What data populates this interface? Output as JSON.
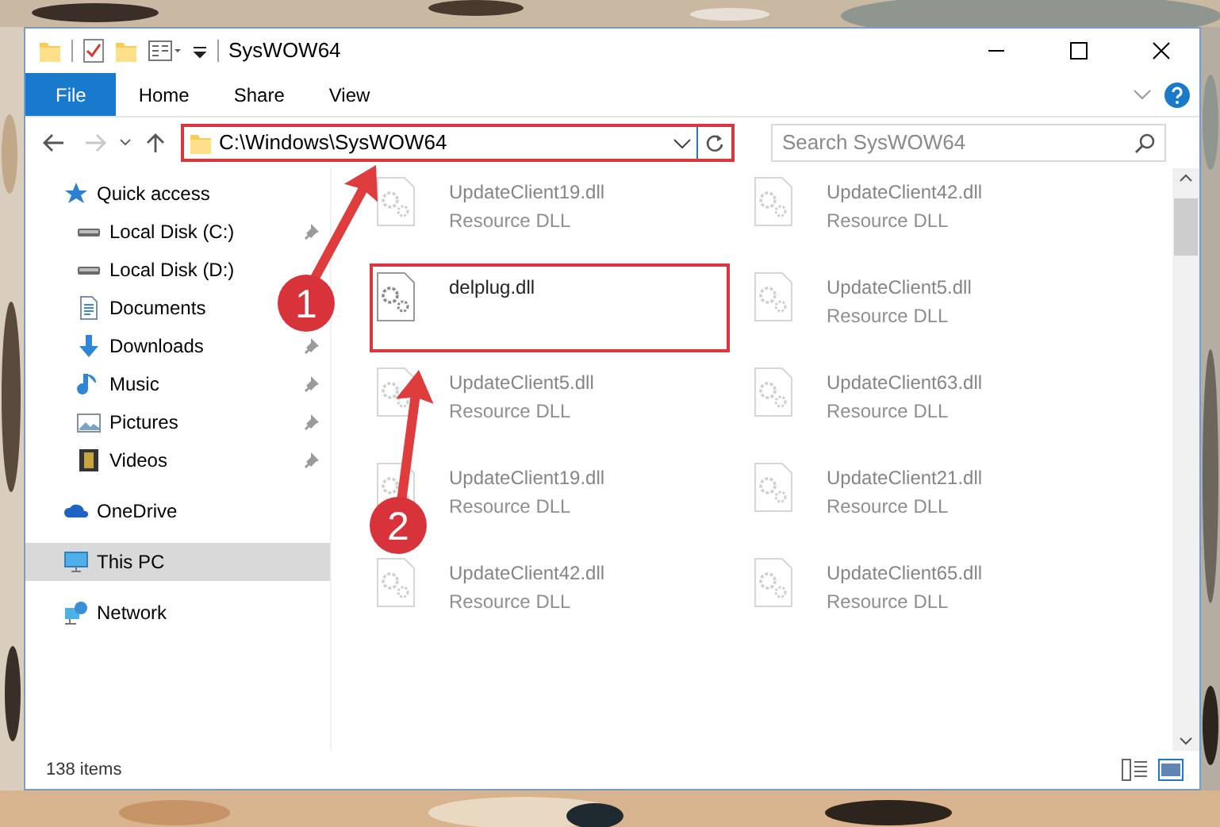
{
  "window": {
    "title": "SysWOW64"
  },
  "ribbon_tabs": [
    {
      "label": "File",
      "selected": true
    },
    {
      "label": "Home",
      "selected": false
    },
    {
      "label": "Share",
      "selected": false
    },
    {
      "label": "View",
      "selected": false
    }
  ],
  "address": {
    "path": "C:\\Windows\\SysWOW64",
    "highlighted": true
  },
  "search": {
    "placeholder": "Search SysWOW64"
  },
  "sidebar": {
    "items": [
      {
        "label": "Quick access",
        "kind": "star",
        "selected": false,
        "children": [
          {
            "label": "Local Disk (C:)",
            "kind": "drive",
            "pinned": true,
            "selected": false
          },
          {
            "label": "Local Disk (D:)",
            "kind": "drive",
            "pinned": false,
            "selected": false
          },
          {
            "label": "Documents",
            "kind": "document",
            "pinned": false,
            "selected": false
          },
          {
            "label": "Downloads",
            "kind": "download",
            "pinned": true,
            "selected": false
          },
          {
            "label": "Music",
            "kind": "music",
            "pinned": true,
            "selected": false
          },
          {
            "label": "Pictures",
            "kind": "picture",
            "pinned": true,
            "selected": false
          },
          {
            "label": "Videos",
            "kind": "video",
            "pinned": true,
            "selected": false
          }
        ]
      },
      {
        "label": "OneDrive",
        "kind": "cloud",
        "selected": false
      },
      {
        "label": "This PC",
        "kind": "computer",
        "selected": true
      },
      {
        "label": "Network",
        "kind": "network",
        "selected": false
      }
    ]
  },
  "files": [
    {
      "name": "UpdateClient19.dll",
      "type": "Resource DLL",
      "faded": true,
      "highlighted": false
    },
    {
      "name": "UpdateClient42.dll",
      "type": "Resource DLL",
      "faded": true,
      "highlighted": false
    },
    {
      "name": "delplug.dll",
      "faded": false,
      "highlighted": true
    },
    {
      "name": "UpdateClient5.dll",
      "type": "Resource DLL",
      "faded": true,
      "highlighted": false
    },
    {
      "name": "UpdateClient5.dll",
      "type": "Resource DLL",
      "faded": true,
      "highlighted": false
    },
    {
      "name": "UpdateClient63.dll",
      "type": "Resource DLL",
      "faded": true,
      "highlighted": false
    },
    {
      "name": "UpdateClient19.dll",
      "type": "Resource DLL",
      "faded": true,
      "highlighted": false
    },
    {
      "name": "UpdateClient21.dll",
      "type": "Resource DLL",
      "faded": true,
      "highlighted": false
    },
    {
      "name": "UpdateClient42.dll",
      "type": "Resource DLL",
      "faded": true,
      "highlighted": false
    },
    {
      "name": "UpdateClient65.dll",
      "type": "Resource DLL",
      "faded": true,
      "highlighted": false
    }
  ],
  "status_bar": {
    "count": "138 items"
  },
  "annotations": [
    {
      "number": "1"
    },
    {
      "number": "2"
    }
  ]
}
